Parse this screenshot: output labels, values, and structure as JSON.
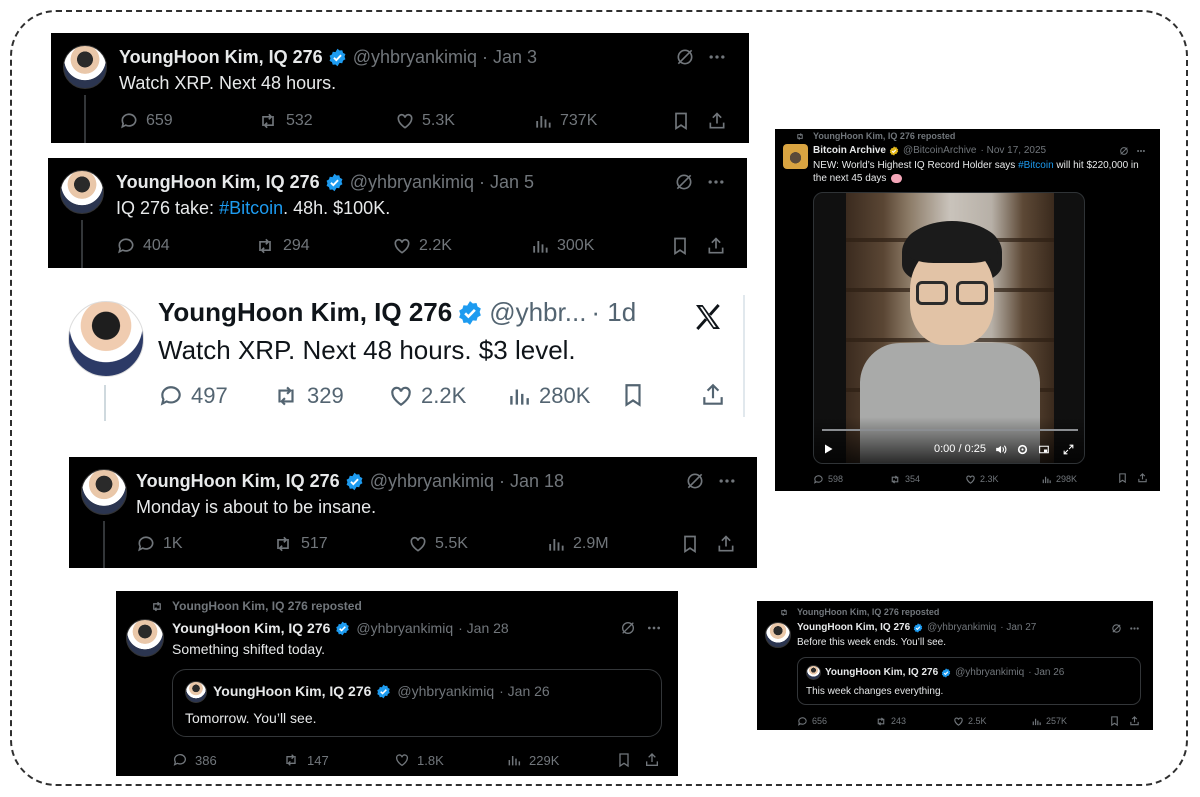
{
  "colors": {
    "accent": "#1d9bf0",
    "verified_blue": "#1d9bf0",
    "verified_gold": "#e2b719",
    "dark_bg": "#000000",
    "muted": "#71767b"
  },
  "tweets": [
    {
      "name": "YoungHoon Kim, IQ 276",
      "handle": "@yhbryankimiq",
      "date": "· Jan 3",
      "text": "Watch XRP. Next 48 hours.",
      "replies": "659",
      "reposts": "532",
      "likes": "5.3K",
      "views": "737K"
    },
    {
      "name": "YoungHoon Kim, IQ 276",
      "handle": "@yhbryankimiq",
      "date": "· Jan 5",
      "text_before": "IQ 276 take: ",
      "hashtag": "#Bitcoin",
      "text_after": ". 48h. $100K.",
      "replies": "404",
      "reposts": "294",
      "likes": "2.2K",
      "views": "300K"
    },
    {
      "name": "YoungHoon Kim, IQ 276",
      "handle": "@yhbr...",
      "date": "· 1d",
      "text": "Watch XRP. Next 48 hours. $3 level.",
      "replies": "497",
      "reposts": "329",
      "likes": "2.2K",
      "views": "280K"
    },
    {
      "name": "YoungHoon Kim, IQ 276",
      "handle": "@yhbryankimiq",
      "date": "· Jan 18",
      "text": "Monday is about to be insane.",
      "replies": "1K",
      "reposts": "517",
      "likes": "5.5K",
      "views": "2.9M"
    },
    {
      "repost_label": "YoungHoon Kim, IQ 276 reposted",
      "name": "YoungHoon Kim, IQ 276",
      "handle": "@yhbryankimiq",
      "date": "· Jan 28",
      "text": "Something shifted today.",
      "quote": {
        "name": "YoungHoon Kim, IQ 276",
        "handle": "@yhbryankimiq",
        "date": "· Jan 26",
        "text": "Tomorrow. You’ll see."
      },
      "replies": "386",
      "reposts": "147",
      "likes": "1.8K",
      "views": "229K"
    },
    {
      "repost_label": "YoungHoon Kim, IQ 276 reposted",
      "name": "Bitcoin Archive",
      "handle": "@BitcoinArchive",
      "date": "· Nov 17, 2025",
      "text_line1_before": "NEW: World’s Highest IQ Record Holder says ",
      "hashtag": "#Bitcoin",
      "text_line1_after": " will hit $220,000 in",
      "text_line2": "the next 45 days",
      "emoji_icon": "brain-icon",
      "video_time": "0:00 / 0:25",
      "replies": "598",
      "reposts": "354",
      "likes": "2.3K",
      "views": "298K"
    },
    {
      "repost_label": "YoungHoon Kim, IQ 276 reposted",
      "name": "YoungHoon Kim, IQ 276",
      "handle": "@yhbryankimiq",
      "date": "· Jan 27",
      "text": "Before this week ends. You’ll see.",
      "quote": {
        "name": "YoungHoon Kim, IQ 276",
        "handle": "@yhbryankimiq",
        "date": "· Jan 26",
        "text": "This week changes everything."
      },
      "replies": "656",
      "reposts": "243",
      "likes": "2.5K",
      "views": "257K"
    }
  ]
}
